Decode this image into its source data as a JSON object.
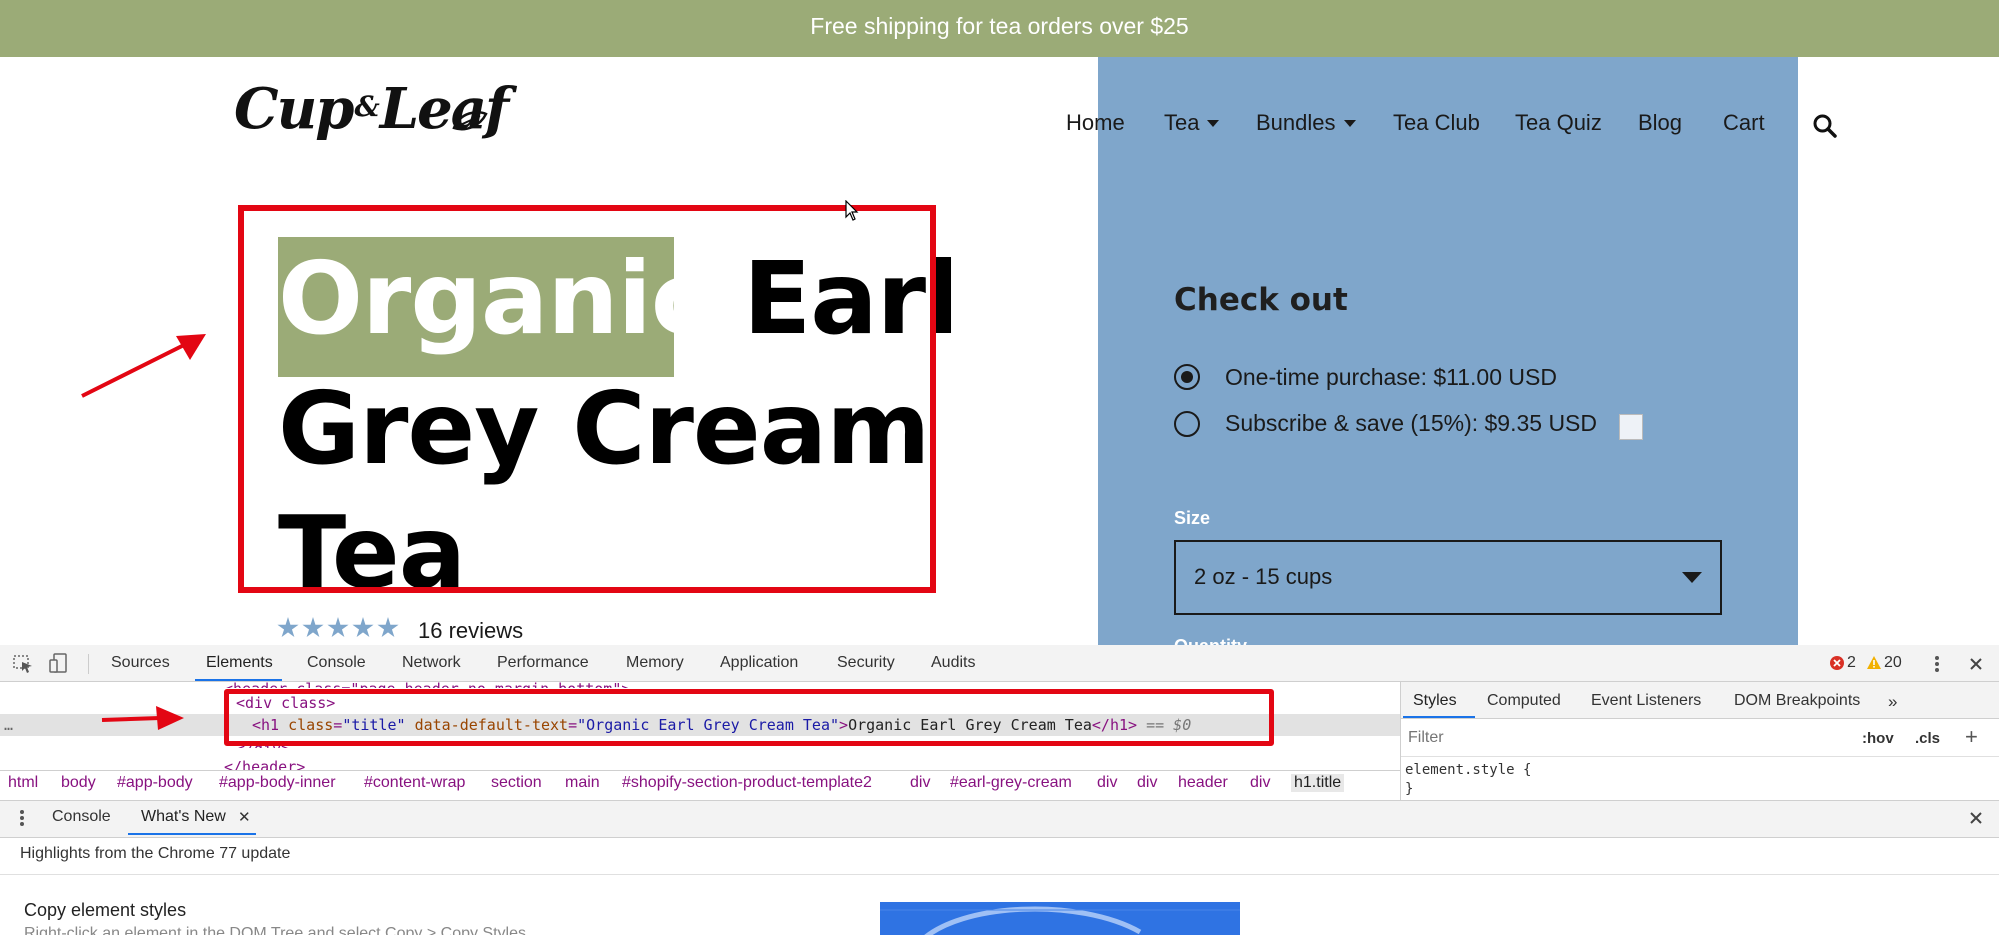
{
  "announcement": "Free shipping for tea orders over $25",
  "logo": {
    "part1": "Cup",
    "amp": "&",
    "part2": "Leaf"
  },
  "nav": {
    "home": "Home",
    "tea": "Tea",
    "bundles": "Bundles",
    "tea_club": "Tea Club",
    "tea_quiz": "Tea Quiz",
    "blog": "Blog",
    "cart": "Cart"
  },
  "product": {
    "title_word1": "Organic",
    "title_rest1": " Earl",
    "title_line2": "Grey Cream",
    "title_line3": "Tea",
    "rating": 5,
    "reviews": "16 reviews"
  },
  "checkout": {
    "title": "Check out",
    "option1": "One-time purchase: $11.00 USD",
    "option2": "Subscribe & save (15%): $9.35 USD",
    "size_label": "Size",
    "size_value": "2 oz - 15 cups",
    "quantity_label": "Quantity"
  },
  "devtools": {
    "tabs": [
      "Sources",
      "Elements",
      "Console",
      "Network",
      "Performance",
      "Memory",
      "Application",
      "Security",
      "Audits"
    ],
    "errors": "2",
    "warnings": "20",
    "dom": {
      "line0": "<header class=\"page-header no-margin-bottom\">",
      "line1_tag": "<div class>",
      "h1_open": "<h1",
      "h1_attr1": "class",
      "h1_val1": "\"title\"",
      "h1_attr2": "data-default-text",
      "h1_val2": "\"Organic Earl Grey Cream Tea\"",
      "h1_text": "Organic Earl Grey Cream Tea",
      "h1_close": "</h1>",
      "h1_suffix": "== $0",
      "line3": "</div>",
      "line4": "</header>"
    },
    "breadcrumbs": [
      "html",
      "body",
      "#app-body",
      "#app-body-inner",
      "#content-wrap",
      "section",
      "main",
      "#shopify-section-product-template2",
      "div",
      "#earl-grey-cream",
      "div",
      "div",
      "header",
      "div",
      "h1.title"
    ],
    "styles_tabs": [
      "Styles",
      "Computed",
      "Event Listeners",
      "DOM Breakpoints"
    ],
    "filter_placeholder": "Filter",
    "hov": ":hov",
    "cls": ".cls",
    "element_style": "element.style {",
    "element_style_close": "}",
    "drawer_tabs": {
      "console": "Console",
      "whats_new": "What's New"
    },
    "highlights": "Highlights from the Chrome 77 update",
    "copy_styles_title": "Copy element styles",
    "copy_styles_desc": "Right-click an element in the DOM Tree and select Copy > Copy Styles."
  },
  "colors": {
    "announcement_bg": "#9bab77",
    "checkout_panel_bg": "#7fa6cb",
    "annotation_red": "#e30613",
    "devtools_accent": "#1a73e8"
  }
}
